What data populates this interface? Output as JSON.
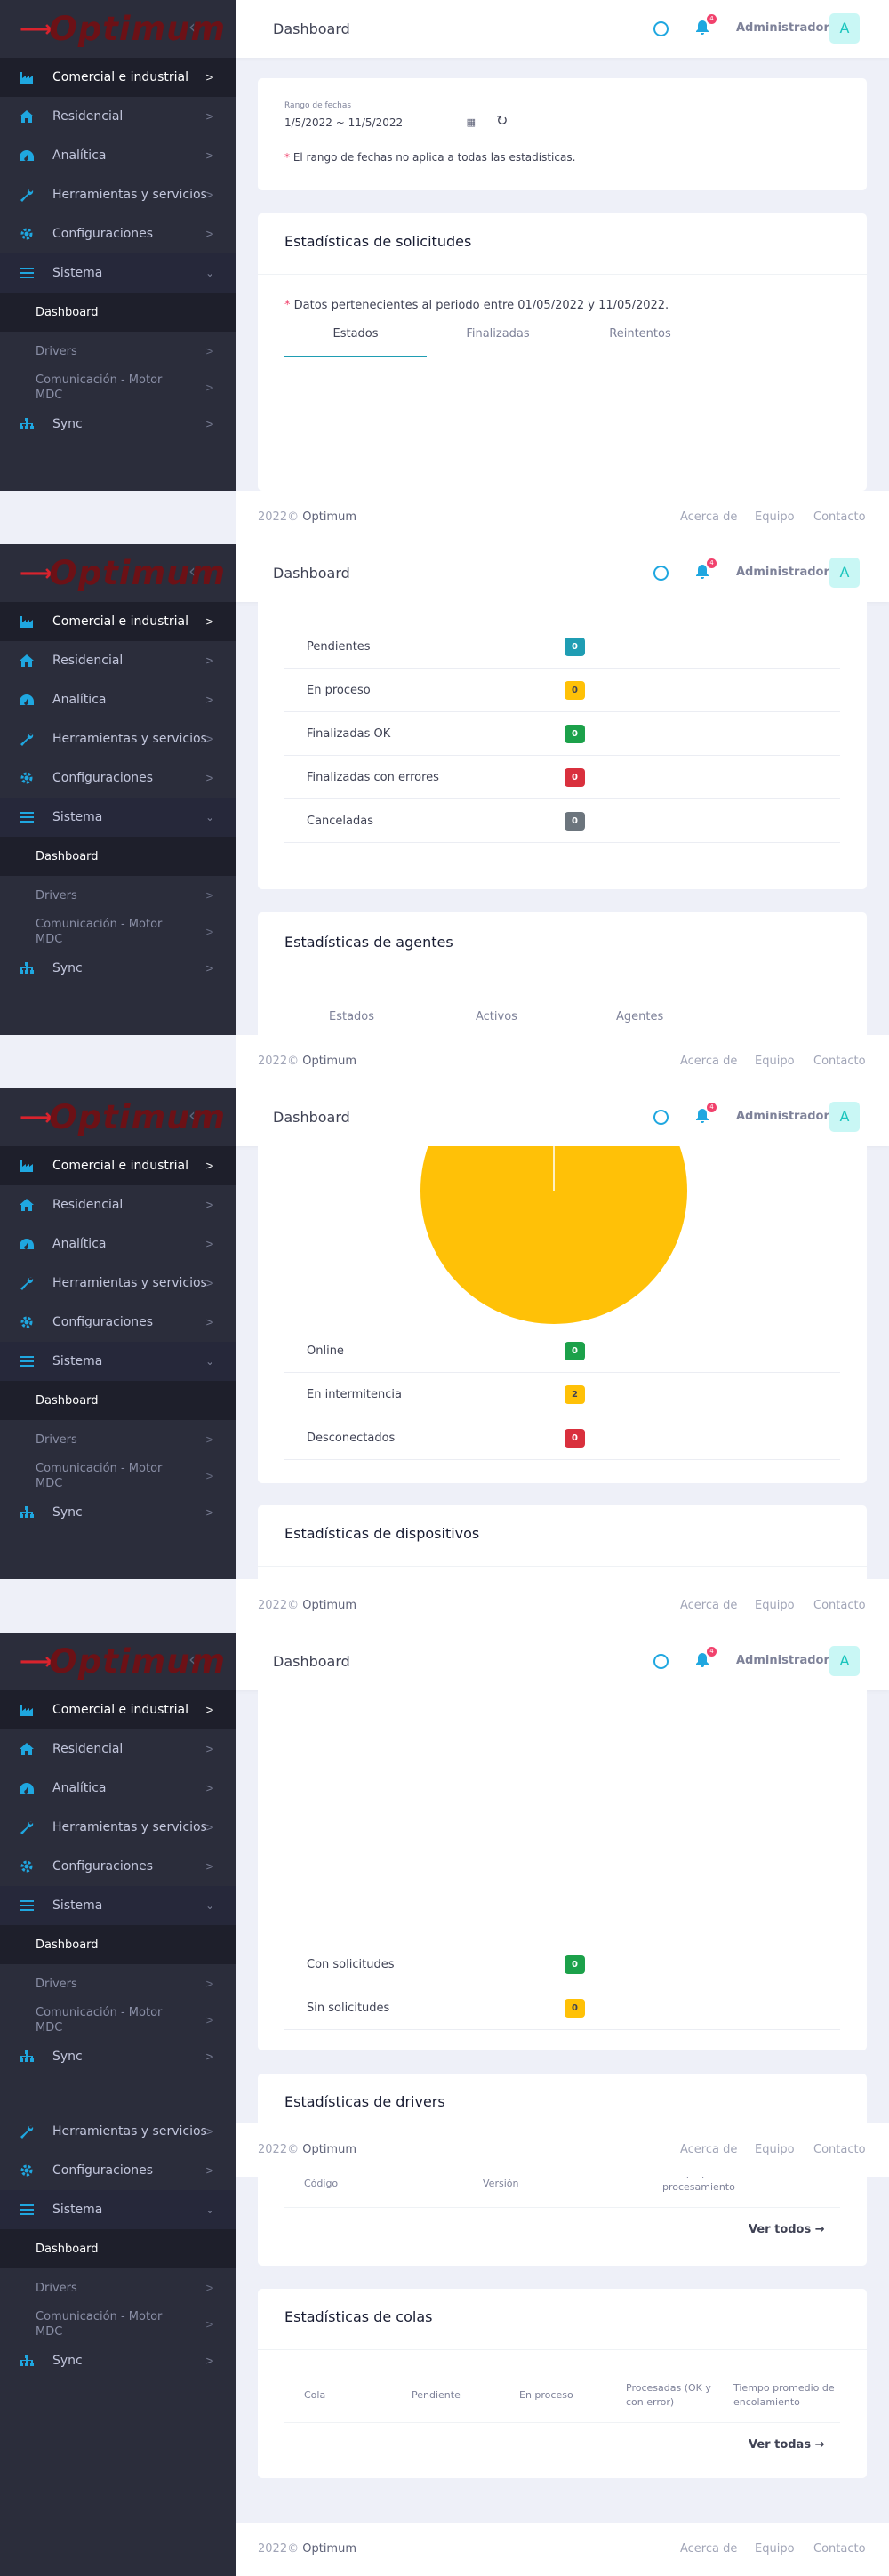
{
  "brand": {
    "arrow": "⟶",
    "name": "Optimum",
    "collapse_icon": "‹"
  },
  "menu": [
    {
      "label": "Comercial e industrial",
      "icon": "factory-icon"
    },
    {
      "label": "Residencial",
      "icon": "home-icon"
    },
    {
      "label": "Analítica",
      "icon": "gauge-icon"
    },
    {
      "label": "Herramientas y servicios",
      "icon": "wrench-icon"
    },
    {
      "label": "Configuraciones",
      "icon": "gear-icon"
    },
    {
      "label": "Sistema",
      "icon": "bars-icon"
    }
  ],
  "submenu": {
    "dashboard": "Dashboard",
    "drivers": "Drivers",
    "comm": "Comunicación - Motor MDC",
    "sync": "Sync"
  },
  "header": {
    "title": "Dashboard",
    "notif_count": "4",
    "user": "Administrador",
    "avatar": "A"
  },
  "date_filter": {
    "label": "Rango de fechas",
    "value": "1/5/2022 ~ 11/5/2022",
    "note_star": "*",
    "note": "El rango de fechas no aplica a todas las estadísticas."
  },
  "solicitudes": {
    "title": "Estadísticas de solicitudes",
    "note": "Datos pertenecientes al periodo entre 01/05/2022 y 11/05/2022.",
    "tabs": [
      "Estados",
      "Finalizadas",
      "Reintentos"
    ],
    "rows": [
      {
        "label": "Pendientes",
        "value": "0",
        "color": "cyan"
      },
      {
        "label": "En proceso",
        "value": "0",
        "color": "yellow"
      },
      {
        "label": "Finalizadas OK",
        "value": "0",
        "color": "green"
      },
      {
        "label": "Finalizadas con errores",
        "value": "0",
        "color": "red"
      },
      {
        "label": "Canceladas",
        "value": "0",
        "color": "gray"
      }
    ]
  },
  "agentes": {
    "title": "Estadísticas de agentes",
    "tabs": [
      "Estados",
      "Activos",
      "Agentes"
    ],
    "rows": [
      {
        "label": "Online",
        "value": "0",
        "color": "green"
      },
      {
        "label": "En intermitencia",
        "value": "2",
        "color": "yellow"
      },
      {
        "label": "Desconectados",
        "value": "0",
        "color": "red"
      }
    ]
  },
  "chart_data": {
    "type": "pie",
    "values": [
      0,
      2,
      0
    ],
    "colors": [
      "#1ca14a",
      "#ffc107",
      "#d9303d"
    ]
  },
  "dispositivos": {
    "title": "Estadísticas de dispositivos",
    "rows": [
      {
        "label": "Con solicitudes",
        "value": "0",
        "color": "green"
      },
      {
        "label": "Sin solicitudes",
        "value": "0",
        "color": "yellow"
      }
    ]
  },
  "drivers": {
    "title": "Estadísticas de drivers",
    "cols": [
      "Código",
      "Versión",
      "Tiempo promedio de procesamiento"
    ],
    "link": "Ver todos"
  },
  "colas": {
    "title": "Estadísticas de colas",
    "cols": [
      "Cola",
      "Pendiente",
      "En proceso",
      "Procesadas (OK y con error)",
      "Tiempo promedio de encolamiento"
    ],
    "link": "Ver todas"
  },
  "footer": {
    "year": "2022©",
    "brand": "Optimum",
    "links": [
      "Acerca de",
      "Equipo",
      "Contacto"
    ]
  }
}
